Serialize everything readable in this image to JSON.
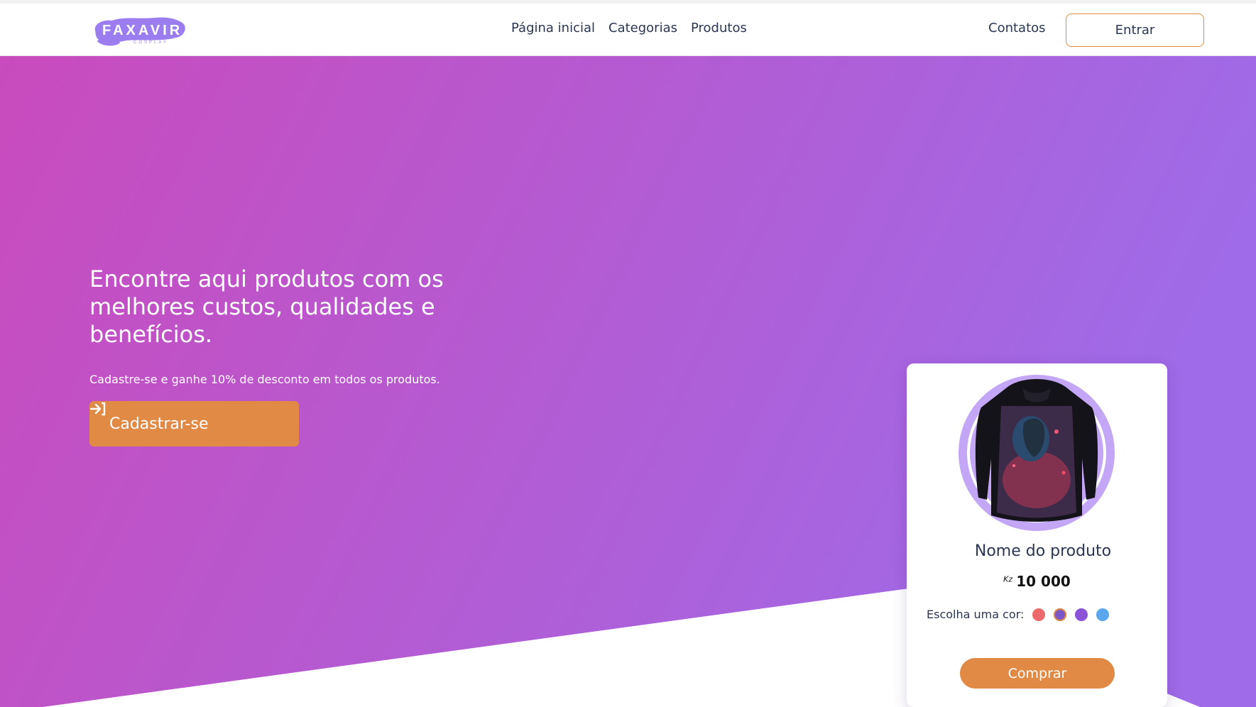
{
  "brand": {
    "logo_text": "FAXAVIR",
    "logo_subtext": "COSPLAY",
    "logo_color": "#9c7df0"
  },
  "nav": {
    "links": [
      "Página inicial",
      "Categorias",
      "Produtos"
    ],
    "contact": "Contatos",
    "login": "Entrar"
  },
  "hero": {
    "title": "Encontre aqui produtos com os melhores custos, qualidades e benefícios.",
    "subtitle": "Cadastre-se e ganhe 10% de desconto em todos os produtos.",
    "signup_label": "Cadastrar-se",
    "gradient_start": "#c94bbd",
    "gradient_end": "#9f6be8"
  },
  "product_card": {
    "name": "Nome do produto",
    "currency": "Kz",
    "price": "10 000",
    "color_label": "Escolha uma cor:",
    "colors": [
      "#ec6a6a",
      "#7a57c6",
      "#8a53d8",
      "#5aa7ee"
    ],
    "selected_color_index": 1,
    "buy_label": "Comprar",
    "image_icon": "hoodie-icon",
    "accent": "#e08a45"
  }
}
